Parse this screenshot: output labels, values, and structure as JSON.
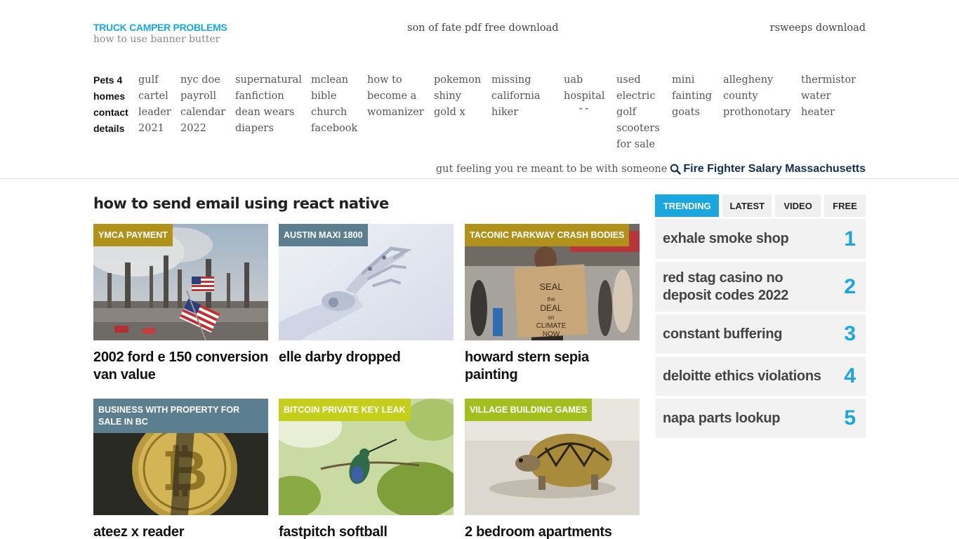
{
  "site": {
    "title": "TRUCK CAMPER PROBLEMS",
    "tagline": "how to use banner butter",
    "center_link": "son of fate pdf free download",
    "right_link": "rsweeps download"
  },
  "nav": [
    {
      "lines": [
        "Pets 4",
        "homes",
        "contact",
        "details"
      ],
      "bold": true
    },
    {
      "lines": [
        "gulf",
        "cartel",
        "leader",
        "2021"
      ]
    },
    {
      "lines": [
        "nyc doe",
        "payroll",
        "calendar",
        "2022"
      ]
    },
    {
      "lines": [
        "supernatural",
        "fanfiction",
        "dean wears",
        "diapers"
      ]
    },
    {
      "lines": [
        "mclean",
        "bible",
        "church",
        "facebook"
      ]
    },
    {
      "lines": [
        "how to",
        "become a",
        "womanizer"
      ]
    },
    {
      "lines": [
        "pokemon",
        "shiny",
        "gold x"
      ]
    },
    {
      "lines": [
        "missing",
        "california",
        "hiker"
      ]
    },
    {
      "lines": [
        "uab",
        "hospital"
      ],
      "has_dropdown": true
    },
    {
      "lines": [
        "used",
        "electric",
        "golf",
        "scooters",
        "for sale"
      ]
    },
    {
      "lines": [
        "mini",
        "fainting",
        "goats"
      ]
    },
    {
      "lines": [
        "allegheny",
        "county",
        "prothonotary"
      ]
    },
    {
      "lines": [
        "thermistor",
        "water",
        "heater"
      ]
    }
  ],
  "search": {
    "text": "gut feeling you re meant to be with someone",
    "strong": "Fire Fighter Salary Massachusetts",
    "icon": "search-icon"
  },
  "section_title": "how to send email using react native",
  "cards": [
    {
      "badge": "YMCA PAYMENT",
      "badge_color": "#b0911a",
      "title": "2002 ford e 150 conversion van value",
      "image": "refinery-flag"
    },
    {
      "badge": "AUSTIN MAXI 1800",
      "badge_color": "#5b7f8f",
      "title": "elle darby dropped",
      "image": "robot-hand"
    },
    {
      "badge": "TACONIC PARKWAY CRASH BODIES",
      "badge_color": "#b0911a",
      "title": "howard stern sepia painting",
      "image": "protest-sign"
    },
    {
      "badge": "BUSINESS WITH PROPERTY FOR SALE IN BC",
      "badge_color": "#5b7f8f",
      "title": "ateez x reader",
      "image": "bitcoin-coin"
    },
    {
      "badge": "BITCOIN PRIVATE KEY LEAK",
      "badge_color": "#c3cf1a",
      "title": "fastpitch softball",
      "image": "hummingbird"
    },
    {
      "badge": "VILLAGE BUILDING GAMES",
      "badge_color": "#a3bf1f",
      "title": "2 bedroom apartments",
      "image": "tortoise"
    }
  ],
  "sidebar": {
    "tabs": [
      "TRENDING",
      "LATEST",
      "VIDEO",
      "FREE"
    ],
    "active_tab": "TRENDING",
    "trending": [
      {
        "label": "exhale smoke shop",
        "rank": "1"
      },
      {
        "label": "red stag casino no deposit codes 2022",
        "rank": "2"
      },
      {
        "label": "constant buffering",
        "rank": "3"
      },
      {
        "label": "deloitte ethics violations",
        "rank": "4"
      },
      {
        "label": "napa parts lookup",
        "rank": "5"
      }
    ]
  },
  "colors": {
    "accent": "#1aa7e0",
    "navy": "#0f3050"
  }
}
